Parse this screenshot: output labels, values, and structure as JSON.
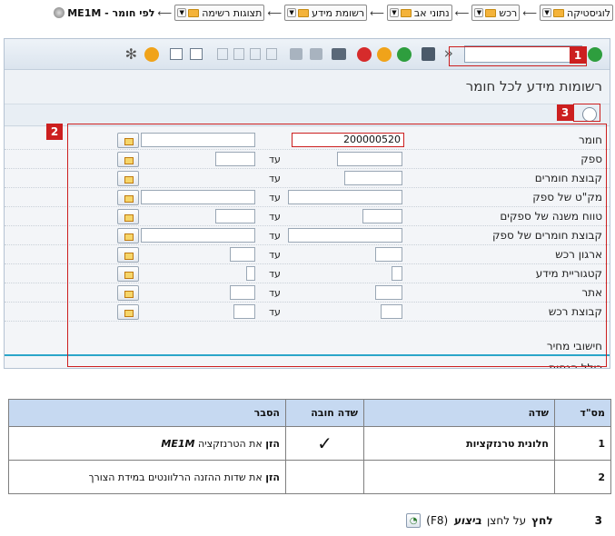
{
  "breadcrumb": {
    "items": [
      "לוגיסטיקה",
      "רכש",
      "נתוני אב",
      "רשומת מידע",
      "תצוגות רשימה"
    ],
    "current": "ME1M - לפי חומר"
  },
  "sap": {
    "title": "רשומות מידע לכל חומר",
    "fields": [
      {
        "label": "חומר",
        "from": "200000520",
        "to": ""
      },
      {
        "label": "ספק",
        "from": "",
        "to": ""
      },
      {
        "label": "קבוצת חומרים",
        "from": "",
        "to": ""
      },
      {
        "label": "מק\"ט של ספק",
        "from": "",
        "to": ""
      },
      {
        "label": "טווח משנה של ספקים",
        "from": "",
        "to": ""
      },
      {
        "label": "קבוצת חומרים של ספק",
        "from": "",
        "to": ""
      },
      {
        "label": "ארגון רכש",
        "from": "",
        "to": ""
      },
      {
        "label": "קטגוריית מידע",
        "from": "",
        "to": ""
      },
      {
        "label": "אתר",
        "from": "",
        "to": ""
      },
      {
        "label": "קבוצת רכש",
        "from": "",
        "to": ""
      }
    ],
    "to_label": "עד",
    "section_price": "חישובי מחיר",
    "section_partial": "כולל הנחות"
  },
  "callouts": [
    "1",
    "2",
    "3"
  ],
  "table": {
    "headers": [
      "מס\"ד",
      "שדה",
      "שדה חובה",
      "הסבר"
    ],
    "rows": [
      {
        "num": "1",
        "field": "חלונית טרנזקציות",
        "mandatory": "✓",
        "expl_bold": "הזן",
        "expl_rest": "את הטרנזקציה",
        "expl_code": "ME1M"
      },
      {
        "num": "2",
        "field": "",
        "mandatory": "",
        "expl_bold": "הזן",
        "expl_rest": "את שדות ההזנה הרלוונטים במידת הצורך",
        "expl_code": ""
      }
    ]
  },
  "step3": {
    "num": "3",
    "press": "לחץ",
    "on_button": "על לחצן",
    "action": "ביצוע",
    "key": "(F8)"
  }
}
